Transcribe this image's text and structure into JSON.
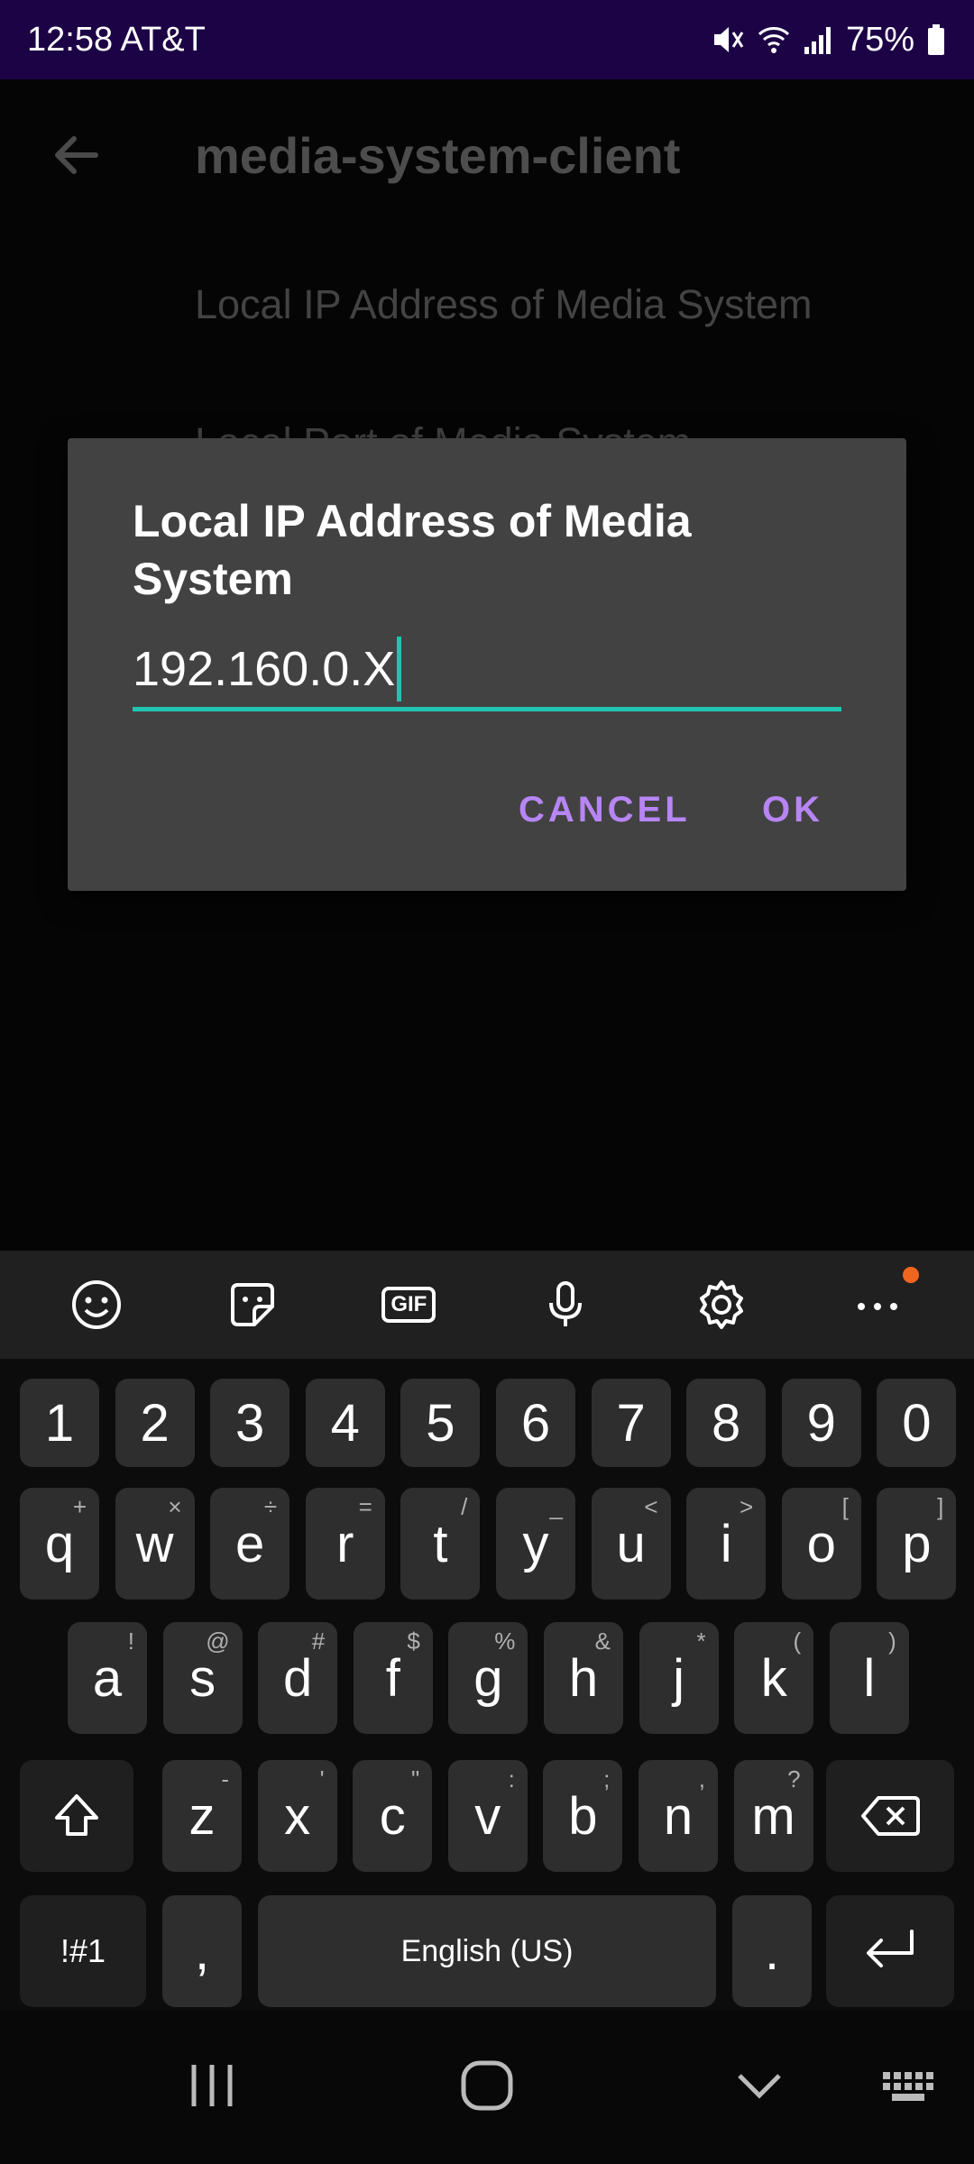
{
  "status_bar": {
    "time_carrier": "12:58 AT&T",
    "battery": "75%"
  },
  "app_bar": {
    "title": "media-system-client"
  },
  "preferences": [
    {
      "label": "Local IP Address of Media System"
    },
    {
      "label": "Local Port of Media System"
    }
  ],
  "dialog": {
    "title": "Local IP Address of Media System",
    "input_value": "192.160.0.X",
    "cancel_label": "CANCEL",
    "ok_label": "OK"
  },
  "keyboard": {
    "toolbar_icons": [
      "emoji-icon",
      "sticker-icon",
      "gif-icon",
      "microphone-icon",
      "settings-icon",
      "more-icon"
    ],
    "gif_label": "GIF",
    "number_row": [
      "1",
      "2",
      "3",
      "4",
      "5",
      "6",
      "7",
      "8",
      "9",
      "0"
    ],
    "row1": [
      {
        "k": "q",
        "h": "+"
      },
      {
        "k": "w",
        "h": "×"
      },
      {
        "k": "e",
        "h": "÷"
      },
      {
        "k": "r",
        "h": "="
      },
      {
        "k": "t",
        "h": "/"
      },
      {
        "k": "y",
        "h": "_"
      },
      {
        "k": "u",
        "h": "<"
      },
      {
        "k": "i",
        "h": ">"
      },
      {
        "k": "o",
        "h": "["
      },
      {
        "k": "p",
        "h": "]"
      }
    ],
    "row2": [
      {
        "k": "a",
        "h": "!"
      },
      {
        "k": "s",
        "h": "@"
      },
      {
        "k": "d",
        "h": "#"
      },
      {
        "k": "f",
        "h": "$"
      },
      {
        "k": "g",
        "h": "%"
      },
      {
        "k": "h",
        "h": "&"
      },
      {
        "k": "j",
        "h": "*"
      },
      {
        "k": "k",
        "h": "("
      },
      {
        "k": "l",
        "h": ")"
      }
    ],
    "row3": [
      {
        "k": "z",
        "h": "-"
      },
      {
        "k": "x",
        "h": "'"
      },
      {
        "k": "c",
        "h": "\""
      },
      {
        "k": "v",
        "h": ":"
      },
      {
        "k": "b",
        "h": ";"
      },
      {
        "k": "n",
        "h": ","
      },
      {
        "k": "m",
        "h": "?"
      }
    ],
    "symbols_label": "!#1",
    "comma_label": ",",
    "space_label": "English (US)",
    "period_label": "."
  }
}
